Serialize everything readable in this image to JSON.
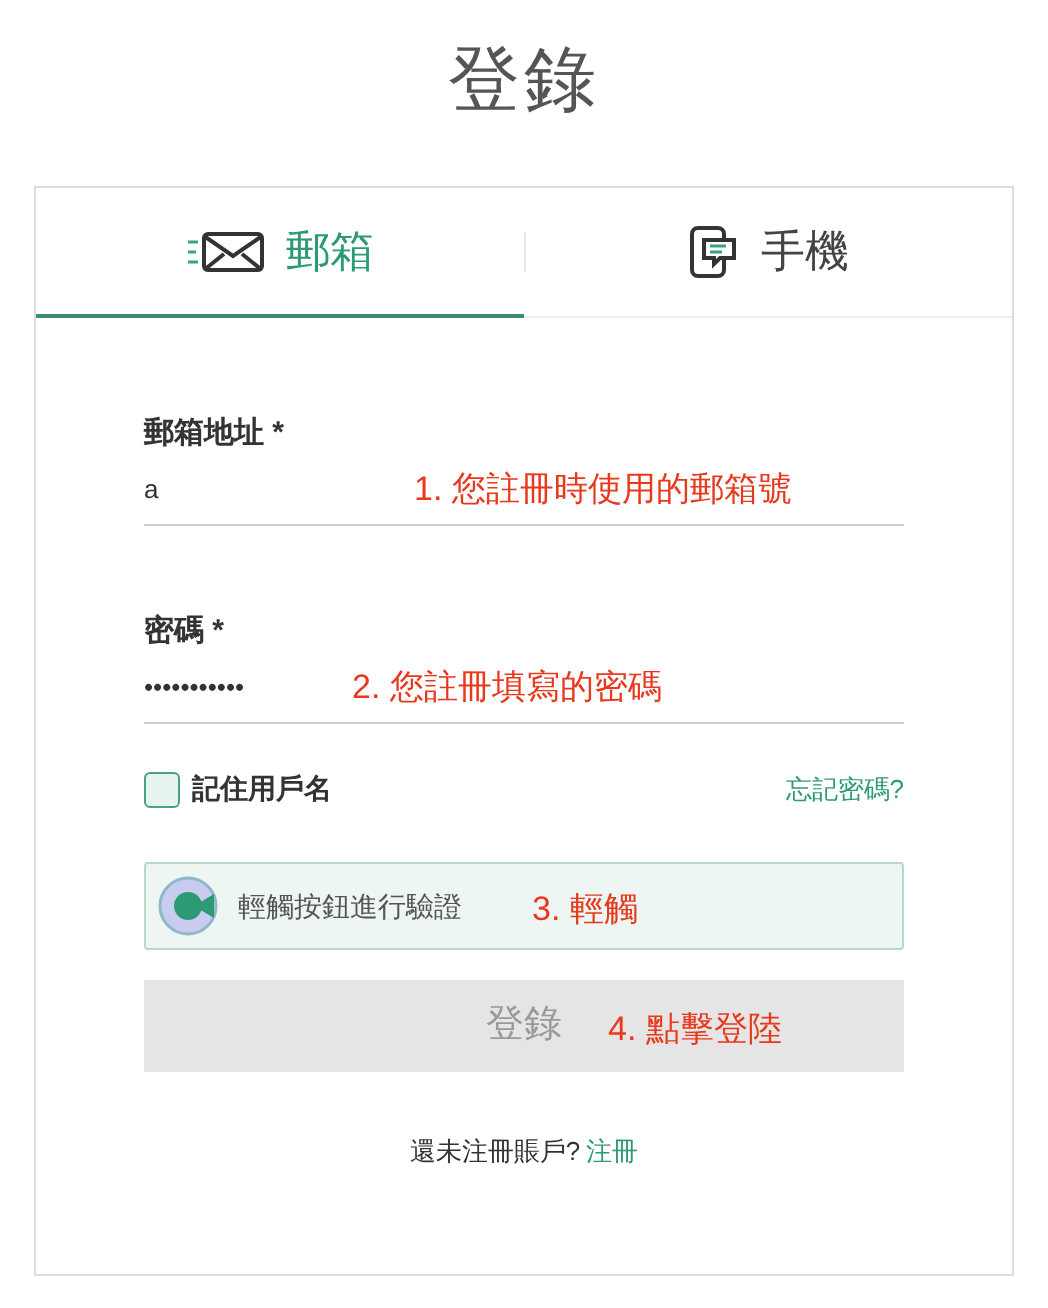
{
  "title": "登錄",
  "tabs": [
    {
      "label": "郵箱",
      "selected": true,
      "kind": "email"
    },
    {
      "label": "手機",
      "selected": false,
      "kind": "phone"
    }
  ],
  "fields": [
    {
      "label": "郵箱地址 *",
      "value": "a",
      "annotation": "1. 您註冊時使用的郵箱號"
    },
    {
      "label": "密碼 *",
      "value": "•••••••••••",
      "annotation": "2. 您註冊填寫的密碼"
    }
  ],
  "remember": {
    "label": "記住用戶名",
    "checked": false
  },
  "forgot_link": "忘記密碼?",
  "captcha": {
    "label": "輕觸按鈕進行驗證",
    "annotation": "3. 輕觸"
  },
  "login_button": {
    "label": "登錄",
    "disabled": true,
    "annotation": "4. 點擊登陸"
  },
  "footer": {
    "text": "還未注冊賬戶?",
    "link": "注冊"
  }
}
